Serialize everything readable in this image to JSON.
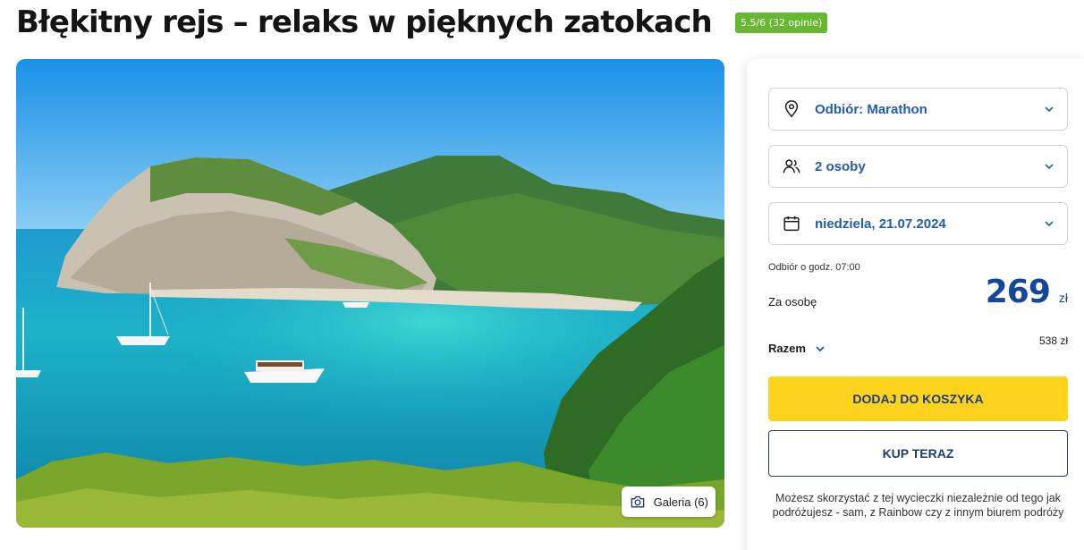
{
  "header": {
    "title": "Błękitny rejs – relaks w pięknych zatokach",
    "rating": "5.5/6 (32 opinie)"
  },
  "gallery": {
    "label": "Galeria (6)",
    "icon": "camera-icon"
  },
  "booking": {
    "pickup": {
      "label": "Odbiór: Marathon",
      "icon": "location-pin-icon"
    },
    "persons": {
      "label": "2 osoby",
      "icon": "people-icon"
    },
    "date": {
      "label": "niedziela, 21.07.2024",
      "icon": "calendar-icon"
    },
    "pickup_time": "Odbiór o godz. 07:00",
    "per_person_label": "Za osobę",
    "price": "269",
    "currency": "zł",
    "total_label": "Razem",
    "total": "538 zł",
    "add_to_cart": "DODAJ DO KOSZYKA",
    "buy_now": "KUP TERAZ",
    "note": "Możesz skorzystać z tej wycieczki niezależnie od tego jak podróżujesz - sam, z Rainbow czy z innym biurem podróży"
  },
  "colors": {
    "rating_badge": "#66b732",
    "accent_blue": "#1f5bbf",
    "price_blue": "#14479a",
    "cart_yellow": "#fdd31d",
    "button_navy": "#1f3b73"
  }
}
